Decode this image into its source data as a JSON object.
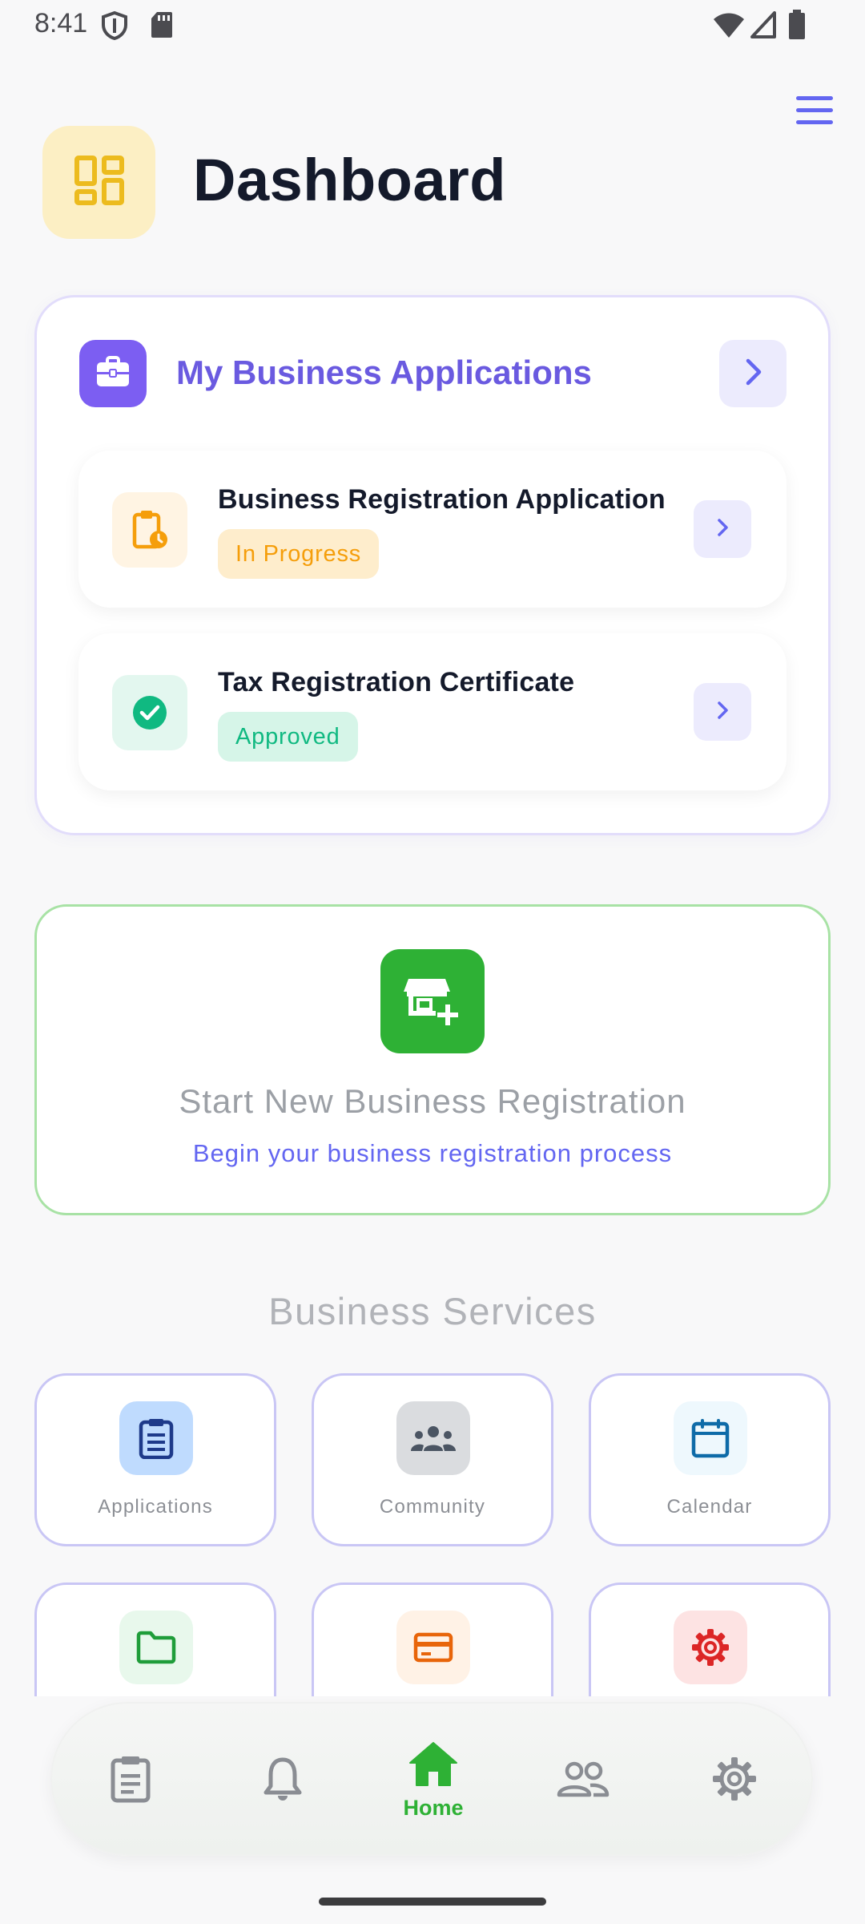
{
  "status_bar": {
    "time": "8:41",
    "icons": [
      "shield-icon",
      "sd-card-icon",
      "wifi-icon",
      "signal-icon",
      "battery-icon"
    ]
  },
  "header": {
    "title": "Dashboard",
    "logo_icon": "dashboard-grid-icon",
    "menu_icon": "hamburger-menu-icon"
  },
  "applications": {
    "title": "My Business Applications",
    "icon": "briefcase-icon",
    "items": [
      {
        "name": "Business Registration Application",
        "status": "In Progress",
        "icon": "clipboard-clock-icon",
        "status_color": "#f59e0b"
      },
      {
        "name": "Tax Registration Certificate",
        "status": "Approved",
        "icon": "check-circle-icon",
        "status_color": "#10b981"
      }
    ]
  },
  "new_registration": {
    "title": "Start New Business Registration",
    "subtitle": "Begin your business registration process",
    "icon": "store-plus-icon"
  },
  "services": {
    "title": "Business Services",
    "tiles": [
      {
        "label": "Applications",
        "icon": "clipboard-list-icon"
      },
      {
        "label": "Community",
        "icon": "people-group-icon"
      },
      {
        "label": "Calendar",
        "icon": "calendar-icon"
      },
      {
        "label": "",
        "icon": "folder-icon"
      },
      {
        "label": "",
        "icon": "credit-card-icon"
      },
      {
        "label": "",
        "icon": "gear-icon"
      }
    ]
  },
  "bottom_nav": {
    "active_label": "Home",
    "items": [
      "clipboard-icon",
      "bell-icon",
      "home-icon",
      "people-icon",
      "settings-icon"
    ]
  },
  "colors": {
    "accent": "#6366f1",
    "brand_green": "#2eb135",
    "in_progress": "#f59e0b",
    "approved": "#10b981"
  }
}
